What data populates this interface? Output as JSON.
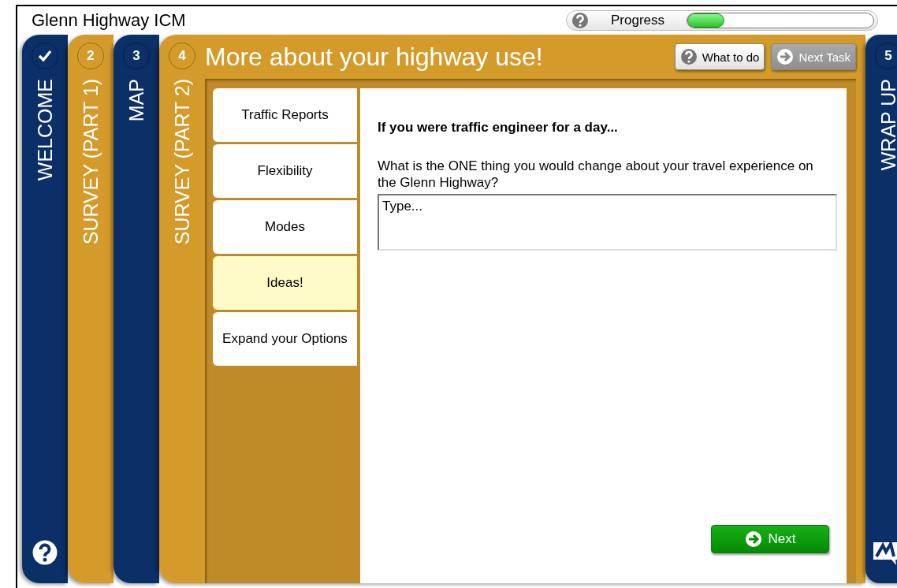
{
  "app_title": "Glenn Highway ICM",
  "progress": {
    "label": "Progress",
    "level": 0.2
  },
  "steps": [
    {
      "kind": "done",
      "label": "WELCOME",
      "color": "#0b2f67",
      "selected": false
    },
    {
      "kind": "number",
      "number": "2",
      "label": "SURVEY (PART 1)",
      "color": "#d49b2a",
      "selected": false
    },
    {
      "kind": "number",
      "number": "3",
      "label": "MAP",
      "color": "#0b2f67",
      "selected": false
    },
    {
      "kind": "number",
      "number": "4",
      "label": "SURVEY (PART 2)",
      "color": "#d49b2a",
      "selected": true
    },
    {
      "kind": "number",
      "number": "5",
      "label": "WRAP UP",
      "color": "#0b2f67",
      "selected": false
    }
  ],
  "page_title": "More about your highway use!",
  "header_buttons": [
    {
      "label": "What to do",
      "kind": "help",
      "disabled": false
    },
    {
      "label": "Next Task",
      "kind": "next",
      "disabled": true
    }
  ],
  "menu": [
    {
      "label": "Traffic Reports",
      "selected": false
    },
    {
      "label": "Flexibility",
      "selected": false
    },
    {
      "label": "Modes",
      "selected": false
    },
    {
      "label": "Ideas!",
      "selected": true
    },
    {
      "label": "Expand your Options",
      "selected": false
    }
  ],
  "question": {
    "heading": "If you were traffic engineer for a day...",
    "prompt": "What is the ONE thing you would change about your travel experience on the Glenn Highway?",
    "placeholder": "Type..."
  },
  "next_button": "Next"
}
